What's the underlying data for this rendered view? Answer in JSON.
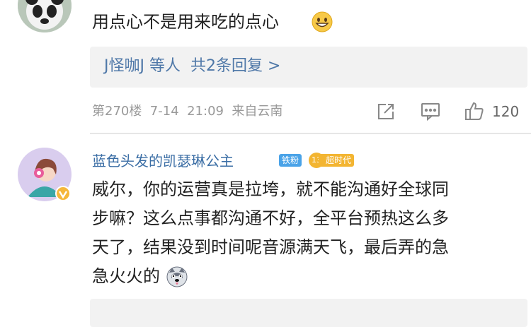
{
  "comment_top": {
    "text": "用点心不是用来吃的点心",
    "emoji_icon": "grin-emoji-icon",
    "replies_label": "J怪咖J 等人  共2条回复 >"
  },
  "meta": {
    "floor_time_source": "第270楼  7-14  21:09  来自云南",
    "like_count": "120",
    "share_icon": "share-icon",
    "comment_icon": "comment-icon",
    "like_icon": "thumbs-up-icon"
  },
  "comment_second": {
    "username": "蓝色头发的凯瑟琳公主",
    "badge_fan": "铁粉",
    "badge_level": "13",
    "badge_level_label": "超时代",
    "lines": [
      "威尔，你的运营真是拉垮，就不能沟通好全球同",
      "步嘛？这么点事都沟通不好，全平台预热这么多",
      "天了，结果没到时间呢音源满天飞，最后弄的急",
      "急火火的"
    ],
    "emoji_icon": "husky-emoji-icon"
  },
  "colors": {
    "link_blue": "#4f78a8",
    "username_blue": "#3b6ea5",
    "meta_gray": "#999999",
    "badge_blue": "#4aa3e8",
    "badge_gold": "#f3b532"
  }
}
